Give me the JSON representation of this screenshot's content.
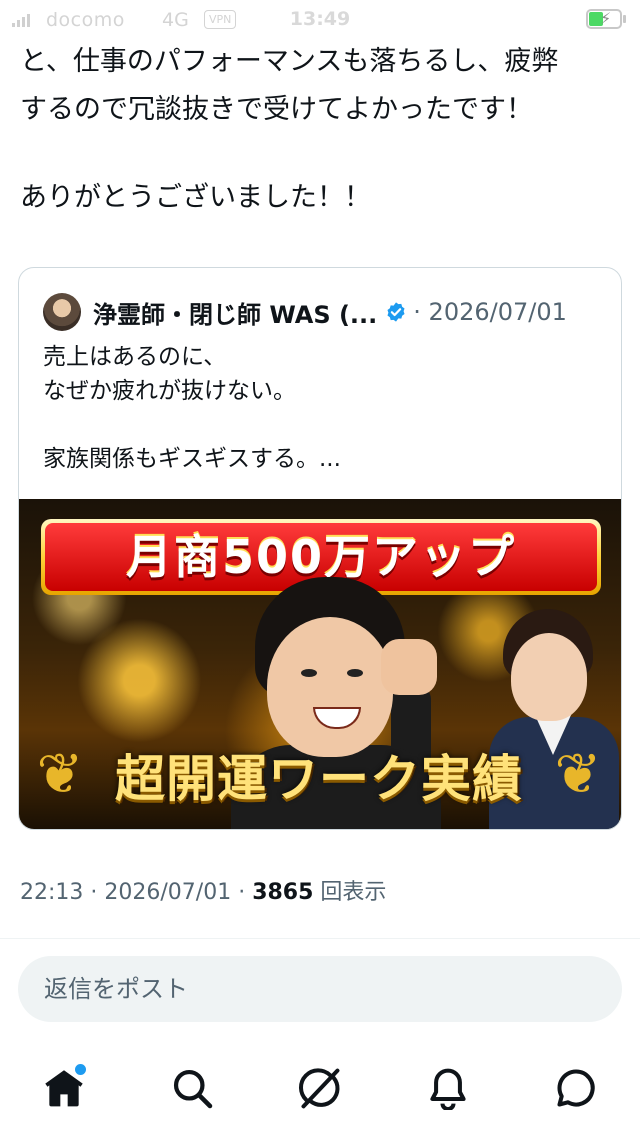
{
  "status_bar": {
    "carrier": "docomo",
    "network": "4G",
    "vpn": "VPN",
    "time": "13:49"
  },
  "tweet": {
    "text_part1": "と、仕事のパフォーマンスも落ちるし、疲弊\nするので冗談抜きで受けてよかったです！",
    "text_part2": "ありがとうございました！！"
  },
  "quote": {
    "author_name": "浄霊師・閉じ師 WAS (...",
    "date": "· 2026/07/01",
    "body": "売上はあるのに、\nなぜか疲れが抜けない。\n\n家族関係もギスギスする。...",
    "media": {
      "banner_top": "月商500万アップ",
      "banner_bottom": "超開運ワーク実績"
    }
  },
  "meta": {
    "time": "22:13",
    "sep1": " · ",
    "date": "2026/07/01",
    "sep2": " · ",
    "views": "3865",
    "views_label": " 回表示"
  },
  "reply": {
    "placeholder": "返信をポスト"
  },
  "tabbar": {
    "items": [
      "home-icon",
      "search-icon",
      "grok-icon",
      "notifications-icon",
      "messages-icon"
    ],
    "has_notification_dot": true
  },
  "colors": {
    "accent": "#1d9bf0",
    "text_secondary": "#536471",
    "text_primary": "#0f1419"
  }
}
